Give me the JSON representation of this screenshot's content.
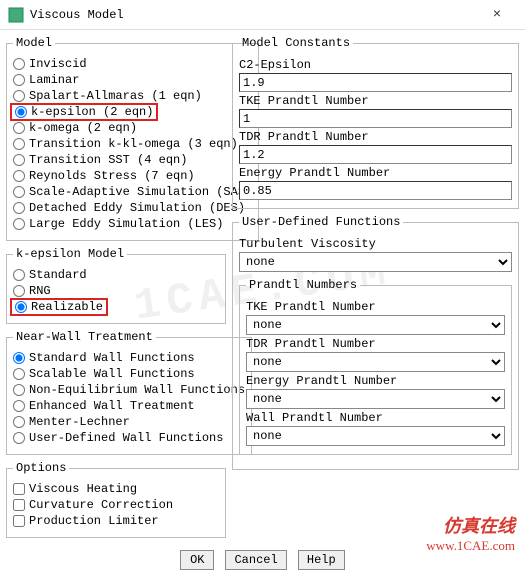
{
  "window": {
    "title": "Viscous Model",
    "close": "×"
  },
  "model": {
    "legend": "Model",
    "items": [
      {
        "label": "Inviscid",
        "checked": false
      },
      {
        "label": "Laminar",
        "checked": false
      },
      {
        "label": "Spalart-Allmaras (1 eqn)",
        "checked": false
      },
      {
        "label": "k-epsilon (2 eqn)",
        "checked": true,
        "highlight": true
      },
      {
        "label": "k-omega (2 eqn)",
        "checked": false
      },
      {
        "label": "Transition k-kl-omega (3 eqn)",
        "checked": false
      },
      {
        "label": "Transition SST (4 eqn)",
        "checked": false
      },
      {
        "label": "Reynolds Stress (7 eqn)",
        "checked": false
      },
      {
        "label": "Scale-Adaptive Simulation (SAS)",
        "checked": false
      },
      {
        "label": "Detached Eddy Simulation (DES)",
        "checked": false
      },
      {
        "label": "Large Eddy Simulation (LES)",
        "checked": false
      }
    ]
  },
  "keModel": {
    "legend": "k-epsilon Model",
    "items": [
      {
        "label": "Standard",
        "checked": false
      },
      {
        "label": "RNG",
        "checked": false
      },
      {
        "label": "Realizable",
        "checked": true,
        "highlight": true
      }
    ]
  },
  "nearWall": {
    "legend": "Near-Wall Treatment",
    "items": [
      {
        "label": "Standard Wall Functions",
        "checked": true
      },
      {
        "label": "Scalable Wall Functions",
        "checked": false
      },
      {
        "label": "Non-Equilibrium Wall Functions",
        "checked": false
      },
      {
        "label": "Enhanced Wall Treatment",
        "checked": false
      },
      {
        "label": "Menter-Lechner",
        "checked": false
      },
      {
        "label": "User-Defined Wall Functions",
        "checked": false
      }
    ]
  },
  "options": {
    "legend": "Options",
    "items": [
      {
        "label": "Viscous Heating",
        "checked": false
      },
      {
        "label": "Curvature Correction",
        "checked": false
      },
      {
        "label": "Production Limiter",
        "checked": false
      }
    ]
  },
  "constants": {
    "legend": "Model Constants",
    "fields": [
      {
        "label": "C2-Epsilon",
        "value": "1.9"
      },
      {
        "label": "TKE Prandtl Number",
        "value": "1"
      },
      {
        "label": "TDR Prandtl Number",
        "value": "1.2"
      },
      {
        "label": "Energy Prandtl Number",
        "value": "0.85"
      }
    ]
  },
  "udf": {
    "legend": "User-Defined Functions",
    "turbVisc": {
      "label": "Turbulent Viscosity",
      "value": "none"
    },
    "prandtl": {
      "legend": "Prandtl Numbers",
      "fields": [
        {
          "label": "TKE Prandtl Number",
          "value": "none"
        },
        {
          "label": "TDR Prandtl Number",
          "value": "none"
        },
        {
          "label": "Energy Prandtl Number",
          "value": "none"
        },
        {
          "label": "Wall Prandtl Number",
          "value": "none"
        }
      ]
    }
  },
  "buttons": {
    "ok": "OK",
    "cancel": "Cancel",
    "help": "Help"
  },
  "watermark": "1CAE.COM",
  "brand": {
    "line1": "仿真在线",
    "line2": "www.1CAE.com"
  }
}
